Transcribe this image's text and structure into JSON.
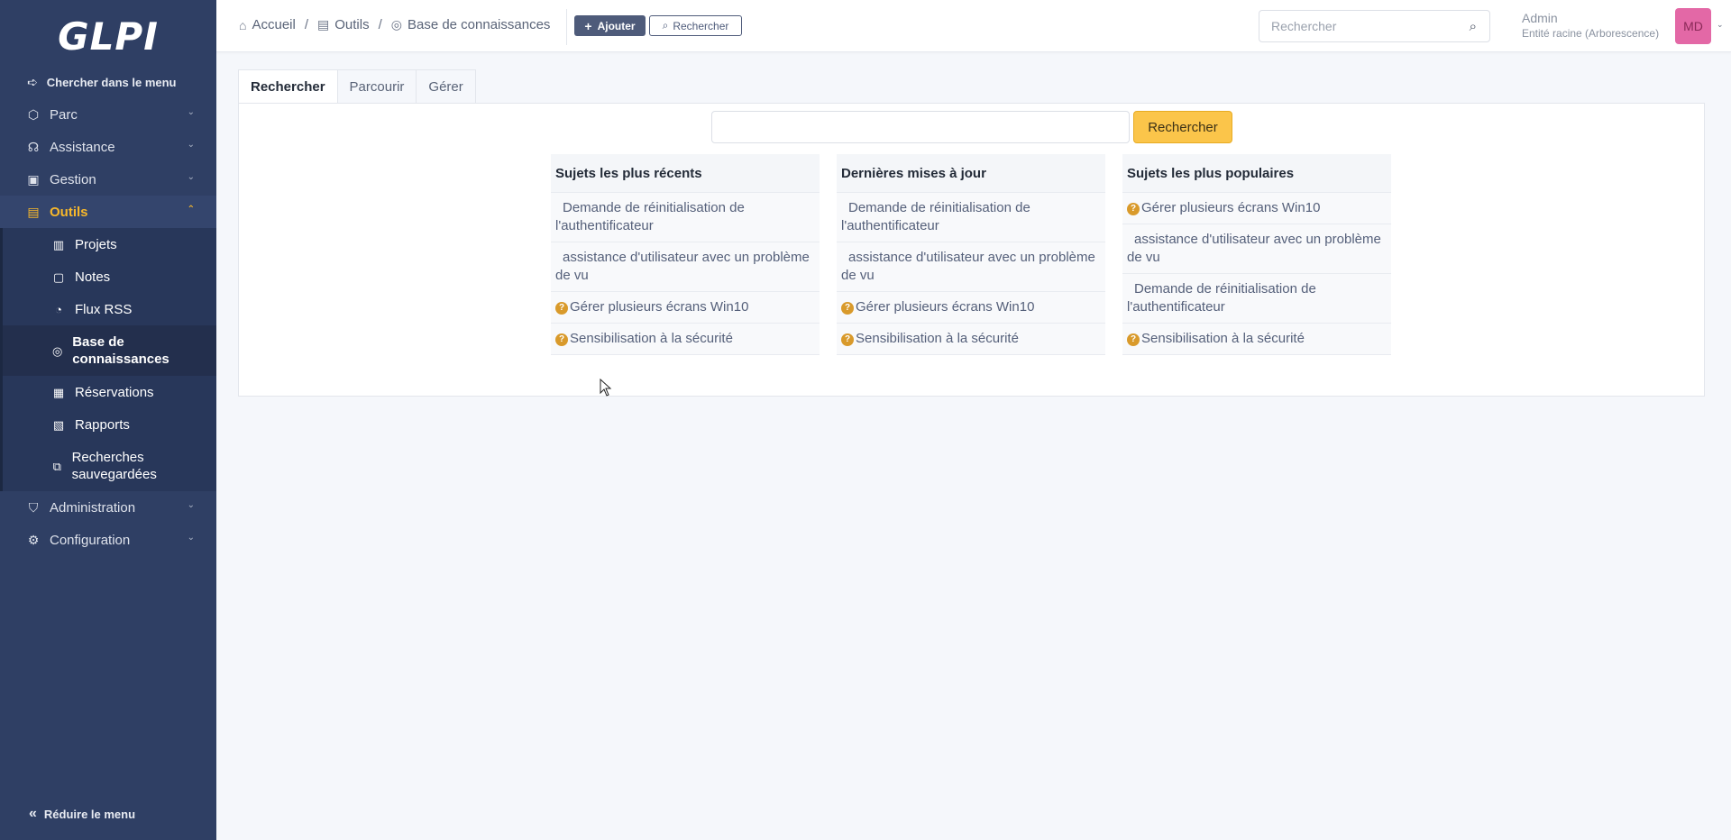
{
  "sidebar": {
    "logo_text": "GLPI",
    "menu_search": "Chercher dans le menu",
    "items": [
      {
        "label": "Parc"
      },
      {
        "label": "Assistance"
      },
      {
        "label": "Gestion"
      },
      {
        "label": "Outils"
      }
    ],
    "tools_sub": [
      {
        "label": "Projets"
      },
      {
        "label": "Notes"
      },
      {
        "label": "Flux RSS"
      },
      {
        "label": "Base de connaissances"
      },
      {
        "label": "Réservations"
      },
      {
        "label": "Rapports"
      },
      {
        "label": "Recherches sauvegardées"
      }
    ],
    "bottom_items": [
      {
        "label": "Administration"
      },
      {
        "label": "Configuration"
      }
    ],
    "collapse_label": "Réduire le menu"
  },
  "header": {
    "breadcrumb": [
      "Accueil",
      "Outils",
      "Base de connaissances"
    ],
    "add_label": "Ajouter",
    "search_label": "Rechercher",
    "global_search_placeholder": "Rechercher",
    "user_name": "Admin",
    "user_entity": "Entité racine (Arborescence)",
    "avatar_initials": "MD"
  },
  "tabs": [
    "Rechercher",
    "Parcourir",
    "Gérer"
  ],
  "search_button": "Rechercher",
  "columns": [
    {
      "title": "Sujets les plus récents",
      "items": [
        {
          "text": "Demande de réinitialisation de l'authentificateur",
          "faq": false
        },
        {
          "text": "assistance d'utilisateur avec un problème de vu",
          "faq": false
        },
        {
          "text": "Gérer plusieurs écrans Win10",
          "faq": true
        },
        {
          "text": "Sensibilisation à la sécurité",
          "faq": true
        }
      ]
    },
    {
      "title": "Dernières mises à jour",
      "items": [
        {
          "text": "Demande de réinitialisation de l'authentificateur",
          "faq": false
        },
        {
          "text": "assistance d'utilisateur avec un problème de vu",
          "faq": false
        },
        {
          "text": "Gérer plusieurs écrans Win10",
          "faq": true
        },
        {
          "text": "Sensibilisation à la sécurité",
          "faq": true
        }
      ]
    },
    {
      "title": "Sujets les plus populaires",
      "items": [
        {
          "text": "Gérer plusieurs écrans Win10",
          "faq": true
        },
        {
          "text": "assistance d'utilisateur avec un problème de vu",
          "faq": false
        },
        {
          "text": "Demande de réinitialisation de l'authentificateur",
          "faq": false
        },
        {
          "text": "Sensibilisation à la sécurité",
          "faq": true
        }
      ]
    }
  ],
  "colors": {
    "sidebar_bg": "#2f3f64",
    "accent": "#f8b82a",
    "search_btn": "#fbc54a",
    "avatar": "#e368a6"
  }
}
